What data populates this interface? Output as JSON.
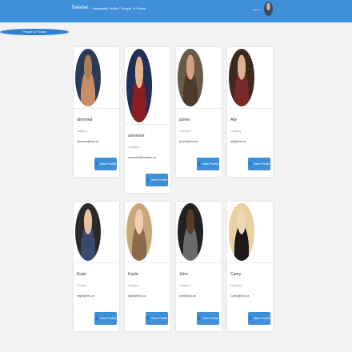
{
  "navbar": {
    "brand": "Tweeter",
    "links": [
      {
        "label": "Newsfeed",
        "icon": "twitter-bird-icon"
      },
      {
        "label": "Profile",
        "icon": "profile-icon"
      },
      {
        "label": "People To Follow",
        "icon": "people-icon"
      }
    ],
    "user_name": "Ahmed"
  },
  "people_button": "People to Follow",
  "view_profile_label": "View Profile",
  "people": [
    {
      "name": "ahmmed",
      "category": "category",
      "email": "ahmmed@imu.ca",
      "colors": [
        "#b07d5a",
        "#2b3b55",
        "#c98c66"
      ]
    },
    {
      "name": "someone",
      "category": "Category",
      "email": "someone@imutech.ca",
      "colors": [
        "#e5b48c",
        "#1f2f55",
        "#8a1c24"
      ]
    },
    {
      "name": "james",
      "category": "Devonian",
      "email": "james@imu.ca",
      "colors": [
        "#d4a27f",
        "#6a5a4a",
        "#4d3a2a"
      ]
    },
    {
      "name": "Ally",
      "category": "category",
      "email": "ally@imu.ca",
      "colors": [
        "#e0b090",
        "#3a2a22",
        "#7a2a2a"
      ]
    },
    {
      "name": "Ergin",
      "category": "Toronto",
      "email": "ergin@imu.ca",
      "colors": [
        "#e6c2a3",
        "#2a2a2a",
        "#3a4a6a"
      ]
    },
    {
      "name": "Kayla",
      "category": "Category",
      "email": "kayla@imu.ca",
      "colors": [
        "#f0cdb0",
        "#c9a77a",
        "#8a6a4a"
      ]
    },
    {
      "name": "John",
      "category": "Category",
      "email": "john@imu.ca",
      "colors": [
        "#5a3a2a",
        "#222222",
        "#6a6a6a"
      ]
    },
    {
      "name": "Carey",
      "category": "Category",
      "email": "Carey@imu.ca",
      "colors": [
        "#f0d6b8",
        "#e8d0a0",
        "#1a1a1a"
      ]
    }
  ]
}
